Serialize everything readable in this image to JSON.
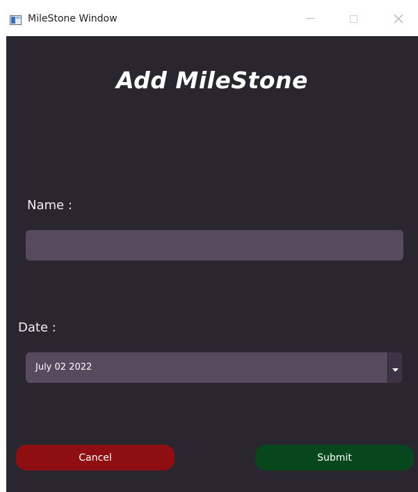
{
  "window": {
    "title": "MileStone Window",
    "controls": {
      "minimize_icon": "minimize-icon",
      "maximize_icon": "maximize-icon",
      "close_icon": "close-icon"
    }
  },
  "form": {
    "heading": "Add MileStone",
    "name_label": "Name :",
    "name_value": "",
    "date_label": "Date :",
    "date_value": "July 02 2022",
    "date_dropdown_icon": "chevron-down-icon"
  },
  "actions": {
    "cancel_label": "Cancel",
    "submit_label": "Submit"
  },
  "colors": {
    "background": "#2a2630",
    "field": "#574a5f",
    "cancel": "#8f0e11",
    "submit": "#08471e",
    "text": "#ffffff"
  }
}
